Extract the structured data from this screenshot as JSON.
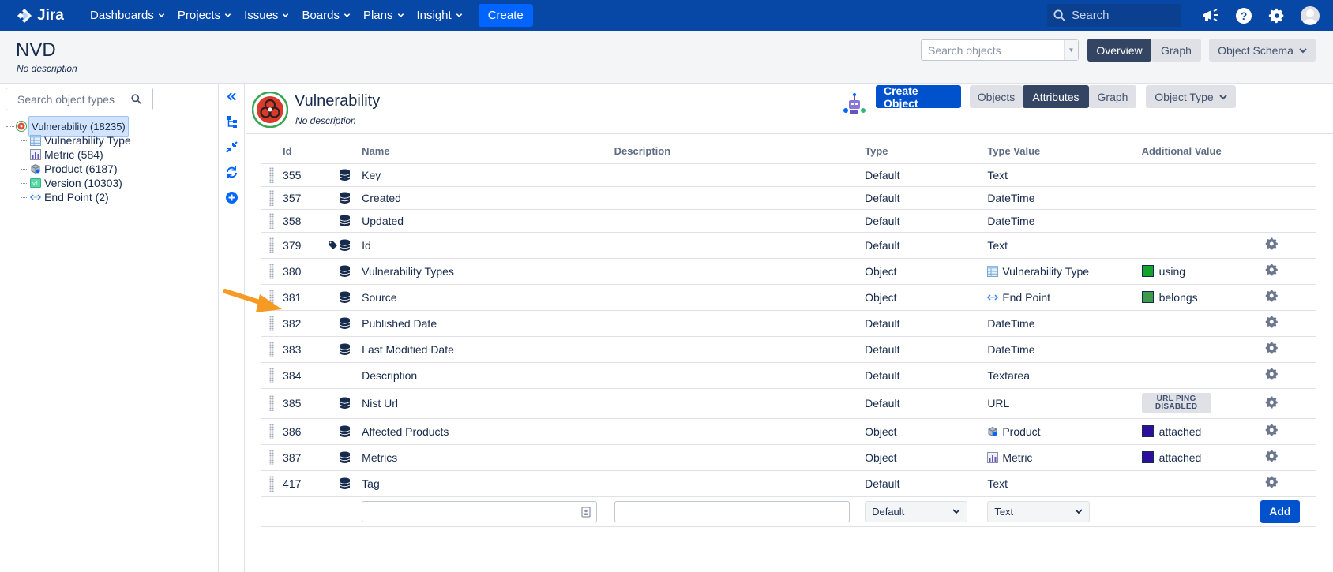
{
  "nav": {
    "brand": "Jira",
    "items": [
      {
        "label": "Dashboards"
      },
      {
        "label": "Projects"
      },
      {
        "label": "Issues"
      },
      {
        "label": "Boards"
      },
      {
        "label": "Plans"
      },
      {
        "label": "Insight"
      }
    ],
    "create_label": "Create",
    "search_placeholder": "Search",
    "icons": [
      "notification-icon",
      "help-icon",
      "settings-icon",
      "avatar"
    ]
  },
  "schema": {
    "title": "NVD",
    "description": "No description",
    "search_placeholder": "Search objects",
    "overview_label": "Overview",
    "graph_label": "Graph",
    "object_schema_label": "Object Schema"
  },
  "sidebar": {
    "search_placeholder": "Search object types",
    "root": {
      "label": "Vulnerability (18235)",
      "icon": "biohazard-icon"
    },
    "children": [
      {
        "label": "Vulnerability Type",
        "icon": "table-icon"
      },
      {
        "label": "Metric (584)",
        "icon": "chart-icon"
      },
      {
        "label": "Product (6187)",
        "icon": "package-icon"
      },
      {
        "label": "Version (10303)",
        "icon": "version-icon"
      },
      {
        "label": "End Point (2)",
        "icon": "code-icon"
      }
    ]
  },
  "object_type": {
    "title": "Vulnerability",
    "description": "No description",
    "create_label": "Create Object",
    "objects_label": "Objects",
    "attributes_label": "Attributes",
    "graph_label": "Graph",
    "object_type_label": "Object Type"
  },
  "table": {
    "headers": {
      "id": "Id",
      "name": "Name",
      "description": "Description",
      "type": "Type",
      "type_value": "Type Value",
      "additional": "Additional Value"
    },
    "rows": [
      {
        "id": "355",
        "icons": [
          "database-icon"
        ],
        "name": "Key",
        "type": "Default",
        "type_value": "Text",
        "tv_icon": "",
        "additional": "",
        "swatch": "",
        "badge": "",
        "gear": false
      },
      {
        "id": "357",
        "icons": [
          "database-icon"
        ],
        "name": "Created",
        "type": "Default",
        "type_value": "DateTime",
        "tv_icon": "",
        "additional": "",
        "swatch": "",
        "badge": "",
        "gear": false
      },
      {
        "id": "358",
        "icons": [
          "database-icon"
        ],
        "name": "Updated",
        "type": "Default",
        "type_value": "DateTime",
        "tv_icon": "",
        "additional": "",
        "swatch": "",
        "badge": "",
        "gear": false
      },
      {
        "id": "379",
        "icons": [
          "tag-icon",
          "database-icon"
        ],
        "name": "Id",
        "type": "Default",
        "type_value": "Text",
        "tv_icon": "",
        "additional": "",
        "swatch": "",
        "badge": "",
        "gear": true
      },
      {
        "id": "380",
        "icons": [
          "database-icon"
        ],
        "name": "Vulnerability Types",
        "type": "Object",
        "type_value": "Vulnerability Type",
        "tv_icon": "table-icon",
        "additional": "using",
        "swatch": "#12a32b",
        "badge": "",
        "gear": true
      },
      {
        "id": "381",
        "icons": [
          "database-icon"
        ],
        "name": "Source",
        "type": "Object",
        "type_value": "End Point",
        "tv_icon": "code-icon",
        "additional": "belongs",
        "swatch": "#3d9b4b",
        "badge": "",
        "gear": true
      },
      {
        "id": "382",
        "icons": [
          "database-icon"
        ],
        "name": "Published Date",
        "type": "Default",
        "type_value": "DateTime",
        "tv_icon": "",
        "additional": "",
        "swatch": "",
        "badge": "",
        "gear": true
      },
      {
        "id": "383",
        "icons": [
          "database-icon"
        ],
        "name": "Last Modified Date",
        "type": "Default",
        "type_value": "DateTime",
        "tv_icon": "",
        "additional": "",
        "swatch": "",
        "badge": "",
        "gear": true
      },
      {
        "id": "384",
        "icons": [],
        "name": "Description",
        "type": "Default",
        "type_value": "Textarea",
        "tv_icon": "",
        "additional": "",
        "swatch": "",
        "badge": "",
        "gear": true
      },
      {
        "id": "385",
        "icons": [
          "database-icon"
        ],
        "name": "Nist Url",
        "type": "Default",
        "type_value": "URL",
        "tv_icon": "",
        "additional": "",
        "swatch": "",
        "badge": "URL PING DISABLED",
        "gear": true
      },
      {
        "id": "386",
        "icons": [
          "database-icon"
        ],
        "name": "Affected Products",
        "type": "Object",
        "type_value": "Product",
        "tv_icon": "package-icon",
        "additional": "attached",
        "swatch": "#2d0f9e",
        "badge": "",
        "gear": true
      },
      {
        "id": "387",
        "icons": [
          "database-icon"
        ],
        "name": "Metrics",
        "type": "Object",
        "type_value": "Metric",
        "tv_icon": "chart-icon",
        "additional": "attached",
        "swatch": "#2d0f9e",
        "badge": "",
        "gear": true
      },
      {
        "id": "417",
        "icons": [
          "database-icon"
        ],
        "name": "Tag",
        "type": "Default",
        "type_value": "Text",
        "tv_icon": "",
        "additional": "",
        "swatch": "",
        "badge": "",
        "gear": true
      }
    ],
    "new_row": {
      "type_select": "Default",
      "type_value_select": "Text",
      "add_label": "Add"
    }
  },
  "colors": {
    "nav_bg": "#0747a6",
    "primary": "#0052cc",
    "dark_button": "#344563",
    "arrow": "#f59a23"
  }
}
